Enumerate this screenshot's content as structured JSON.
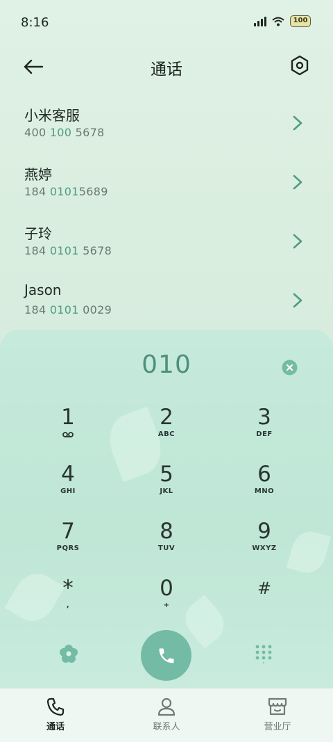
{
  "status_bar": {
    "time": "8:16",
    "battery": "100"
  },
  "header": {
    "title": "通话",
    "back_icon": "arrow-left-icon",
    "settings_icon": "hexagon-settings-icon"
  },
  "contacts": [
    {
      "name": "小米客服",
      "number_pre": "400 ",
      "number_match": "100",
      "number_post": " 5678"
    },
    {
      "name": "燕婷",
      "number_pre": "184 ",
      "number_match": "0101",
      "number_post": "5689"
    },
    {
      "name": "子玲",
      "number_pre": "184 ",
      "number_match": "0101",
      "number_post": " 5678"
    },
    {
      "name": "Jason",
      "number_pre": "184 ",
      "number_match": "0101",
      "number_post": " 0029"
    }
  ],
  "dialpad": {
    "display": "010",
    "keys": [
      {
        "digit": "1",
        "letters": ""
      },
      {
        "digit": "2",
        "letters": "ABC"
      },
      {
        "digit": "3",
        "letters": "DEF"
      },
      {
        "digit": "4",
        "letters": "GHI"
      },
      {
        "digit": "5",
        "letters": "JKL"
      },
      {
        "digit": "6",
        "letters": "MNO"
      },
      {
        "digit": "7",
        "letters": "PQRS"
      },
      {
        "digit": "8",
        "letters": "TUV"
      },
      {
        "digit": "9",
        "letters": "WXYZ"
      },
      {
        "digit": "*",
        "letters": ","
      },
      {
        "digit": "0",
        "letters": "+"
      },
      {
        "digit": "#",
        "letters": ""
      }
    ]
  },
  "bottom_nav": [
    {
      "label": "通话",
      "icon": "phone-icon",
      "active": true
    },
    {
      "label": "联系人",
      "icon": "person-icon",
      "active": false
    },
    {
      "label": "营业厅",
      "icon": "store-icon",
      "active": false
    }
  ],
  "colors": {
    "accent": "#74bba5",
    "highlight_digits": "#4f9c84",
    "display_digits": "#4e8f7d"
  }
}
